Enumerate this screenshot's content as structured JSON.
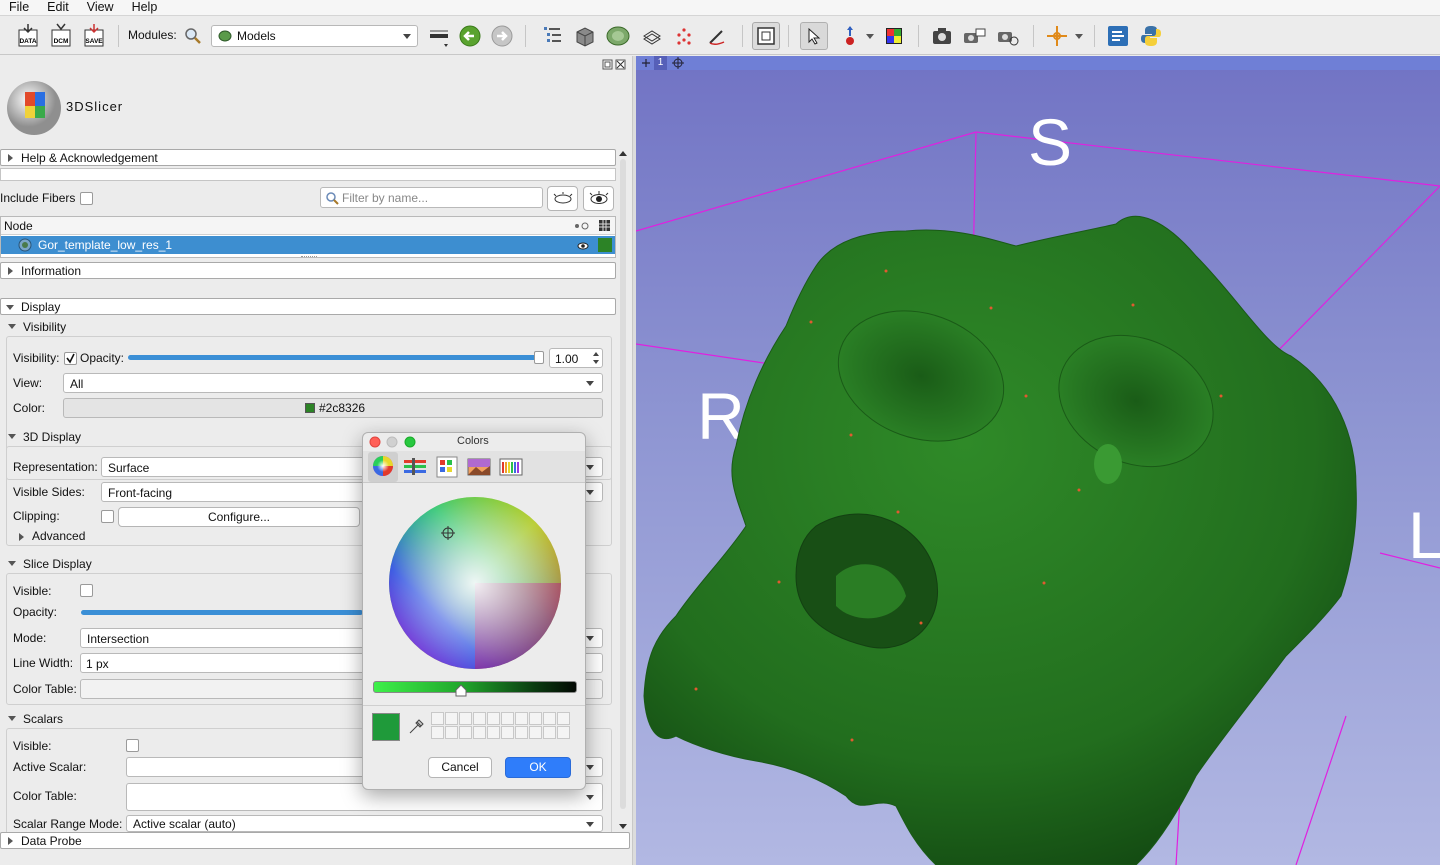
{
  "menu": [
    "File",
    "Edit",
    "View",
    "Help"
  ],
  "toolbar": {
    "data_label": "DATA",
    "dcm_label": "DCM",
    "save_label": "SAVE",
    "modules_label": "Modules:",
    "module_selected": "Models",
    "icons": [
      "data-icon",
      "dicom-icon",
      "save-icon",
      "module-search-icon",
      "module-history-icon",
      "back-icon",
      "forward-icon",
      "data-module-icon",
      "volumes-icon",
      "models-icon",
      "transforms-icon",
      "markups-icon",
      "segment-editor-icon",
      "layout-icon",
      "pointer-icon",
      "place-fiducial-icon",
      "window-level-icon",
      "screenshot-icon",
      "scene-view-icon",
      "capture-icon",
      "crosshair-icon",
      "extensions-icon",
      "python-icon"
    ]
  },
  "panel": {
    "logo_text": "3DSlicer",
    "help_section": "Help & Acknowledgement",
    "include_fibers_label": "Include Fibers",
    "filter_placeholder": "Filter by name...",
    "node_header": "Node",
    "selected_node": "Gor_template_low_res_1",
    "information_section": "Information",
    "display_section": "Display",
    "visibility_section": "Visibility",
    "visibility_label": "Visibility:",
    "opacity_label": "Opacity:",
    "opacity_value": "1.00",
    "view_label": "View:",
    "view_value": "All",
    "color_label": "Color:",
    "color_value": "#2c8326",
    "display3d_section": "3D Display",
    "representation_label": "Representation:",
    "representation_value": "Surface",
    "visible_sides_label": "Visible Sides:",
    "visible_sides_value": "Front-facing",
    "clipping_label": "Clipping:",
    "configure_label": "Configure...",
    "advanced_label": "Advanced",
    "slice_display_section": "Slice Display",
    "visible_label": "Visible:",
    "slice_opacity_label": "Opacity:",
    "mode_label": "Mode:",
    "mode_value": "Intersection",
    "line_width_label": "Line Width:",
    "line_width_value": "1 px",
    "color_table_label": "Color Table:",
    "scalars_section": "Scalars",
    "scalars_visible_label": "Visible:",
    "active_scalar_label": "Active Scalar:",
    "scalars_color_table_label": "Color Table:",
    "scalar_range_label": "Scalar Range Mode:",
    "scalar_range_value": "Active scalar (auto)",
    "data_probe_section": "Data Probe"
  },
  "view3d": {
    "view_number": "1",
    "label_s": "S",
    "label_r": "R",
    "label_l": "L",
    "model_color": "#2c8326"
  },
  "colors_dialog": {
    "title": "Colors",
    "cancel_label": "Cancel",
    "ok_label": "OK",
    "current_color": "#1f9a3a",
    "tabs": [
      "color-wheel-icon",
      "color-sliders-icon",
      "color-palettes-icon",
      "image-palettes-icon",
      "pencils-icon"
    ]
  }
}
